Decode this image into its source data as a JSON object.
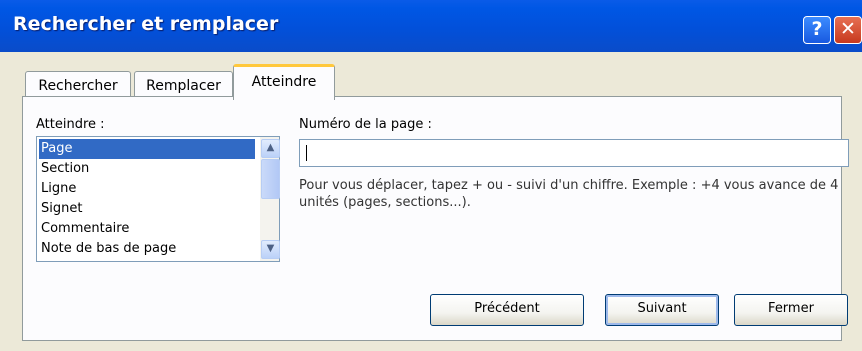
{
  "window": {
    "title": "Rechercher et remplacer",
    "help_glyph": "?",
    "close_glyph": "✕"
  },
  "tabs": [
    {
      "label": "Rechercher",
      "active": false
    },
    {
      "label": "Remplacer",
      "active": false
    },
    {
      "label": "Atteindre",
      "active": true
    }
  ],
  "goto": {
    "list_label": "Atteindre :",
    "items": [
      "Page",
      "Section",
      "Ligne",
      "Signet",
      "Commentaire",
      "Note de bas de page"
    ],
    "selected_index": 0,
    "field_label": "Numéro de la page :",
    "field_value": "",
    "help_text": "Pour vous déplacer, tapez + ou - suivi d'un chiffre. Exemple : +4 vous avance de 4 unités (pages, sections...)."
  },
  "buttons": {
    "previous": "Précédent",
    "next": "Suivant",
    "close": "Fermer"
  },
  "colors": {
    "titlebar": "#0054E3",
    "selection": "#316AC5",
    "active_tab_accent": "#FFC83C"
  }
}
